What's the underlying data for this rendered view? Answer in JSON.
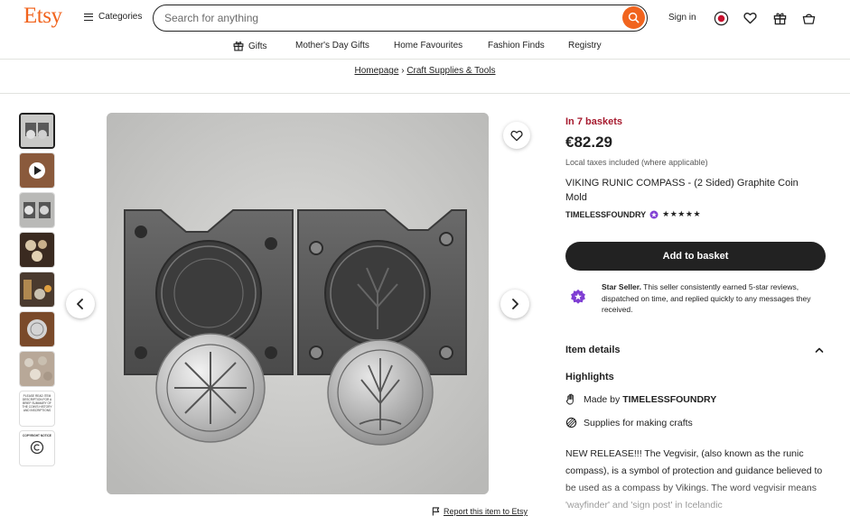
{
  "header": {
    "logo": "Etsy",
    "categories_label": "Categories",
    "search_placeholder": "Search for anything",
    "signin_label": "Sign in",
    "icons": [
      "search-icon",
      "currency-icon",
      "heart-icon",
      "gift-icon",
      "basket-icon"
    ]
  },
  "nav": {
    "items": [
      {
        "label": "Gifts",
        "icon": "gift-icon"
      },
      {
        "label": "Mother's Day Gifts"
      },
      {
        "label": "Home Favourites"
      },
      {
        "label": "Fashion Finds"
      },
      {
        "label": "Registry"
      }
    ]
  },
  "breadcrumb": {
    "items": [
      "Homepage",
      "Craft Supplies & Tools"
    ],
    "separator": "›"
  },
  "gallery": {
    "thumbnail_count": 9,
    "thumb_7_caption": "PLEASE READ ITEM DESCRIPTION FOR A BRIEF SUMMARY OF THE COIN'S HISTORY AND INSCRIPTIONS",
    "thumb_8_caption": "COPYRIGHT NOTICE",
    "report_label": "Report this item to Etsy"
  },
  "product": {
    "in_baskets": "In 7 baskets",
    "price": "€82.29",
    "taxes_note": "Local taxes included (where applicable)",
    "title": "VIKING RUNIC COMPASS - (2 Sided) Graphite Coin Mold",
    "shop_name": "TIMELESSFOUNDRY",
    "rating_stars": "★★★★★",
    "add_to_basket_label": "Add to basket",
    "star_seller_title": "Star Seller.",
    "star_seller_text": " This seller consistently earned 5-star reviews, dispatched on time, and replied quickly to any messages they received.",
    "item_details_label": "Item details",
    "highlights_label": "Highlights",
    "highlights": [
      {
        "prefix": "Made by ",
        "bold": "TIMELESSFOUNDRY",
        "icon": "hand-icon"
      },
      {
        "prefix": "Supplies for making crafts",
        "bold": "",
        "icon": "craft-icon"
      }
    ],
    "description": "NEW RELEASE!!! The Vegvisir, (also known as the runic compass), is a symbol of protection and guidance believed to be used as a compass by Vikings. The word vegvisir means 'wayfinder' and 'sign post' in Icelandic"
  },
  "colors": {
    "brand": "#f1641e",
    "baskets": "#a61a2e",
    "button": "#222222",
    "star_seller": "#7f3ed3"
  }
}
